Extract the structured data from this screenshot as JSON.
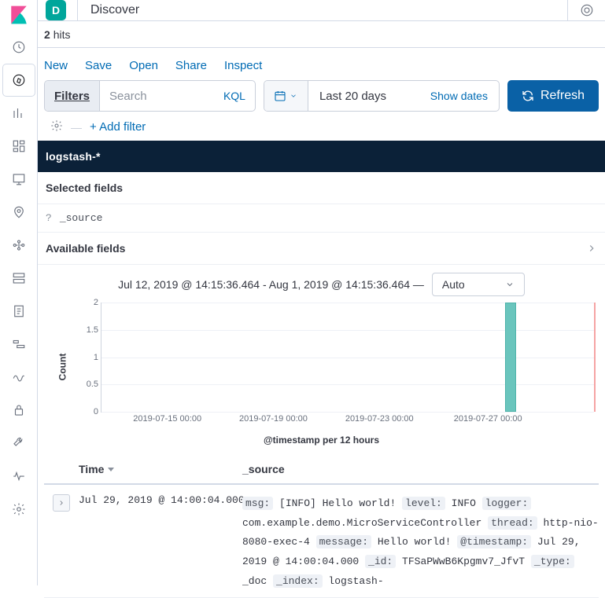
{
  "space_initial": "D",
  "breadcrumb": "Discover",
  "hits_count": "2",
  "hits_label": "hits",
  "top_menu": [
    "New",
    "Save",
    "Open",
    "Share",
    "Inspect"
  ],
  "filters_label": "Filters",
  "search": {
    "placeholder": "Search",
    "language": "KQL"
  },
  "datepicker": {
    "label": "Last 20 days",
    "show": "Show dates"
  },
  "refresh": "Refresh",
  "add_filter": "+ Add filter",
  "index_pattern": "logstash-*",
  "selected_fields_label": "Selected fields",
  "selected_fields": [
    {
      "type": "?",
      "name": "_source"
    }
  ],
  "available_fields_label": "Available fields",
  "chart_range": "Jul 12, 2019 @ 14:15:36.464 - Aug 1, 2019 @ 14:15:36.464 —",
  "interval_select": "Auto",
  "chart_data": {
    "type": "bar",
    "ylabel": "Count",
    "xlabel": "@timestamp per 12 hours",
    "ylim": [
      0,
      2
    ],
    "yticks": [
      0,
      0.5,
      1,
      1.5,
      2
    ],
    "xticks": [
      "2019-07-15 00:00",
      "2019-07-19 00:00",
      "2019-07-23 00:00",
      "2019-07-27 00:00"
    ],
    "xtick_pos_pct": [
      13.5,
      35,
      56.5,
      78.5
    ],
    "bars": [
      {
        "x_pct": 83,
        "value": 2
      }
    ]
  },
  "table": {
    "columns": [
      "Time",
      "_source"
    ],
    "rows": [
      {
        "time": "Jul 29, 2019 @ 14:00:04.000",
        "fields": [
          {
            "k": "msg:",
            "v": "[INFO] Hello world!"
          },
          {
            "k": "level:",
            "v": "INFO"
          },
          {
            "k": "logger:",
            "v": "com.example.demo.MicroServiceController"
          },
          {
            "k": "thread:",
            "v": "http-nio-8080-exec-4"
          },
          {
            "k": "message:",
            "v": "Hello world!"
          },
          {
            "k": "@timestamp:",
            "v": "Jul 29, 2019 @ 14:00:04.000"
          },
          {
            "k": "_id:",
            "v": "TFSaPWwB6Kpgmv7_JfvT"
          },
          {
            "k": "_type:",
            "v": "_doc"
          },
          {
            "k": "_index:",
            "v": "logstash-"
          }
        ]
      }
    ]
  }
}
